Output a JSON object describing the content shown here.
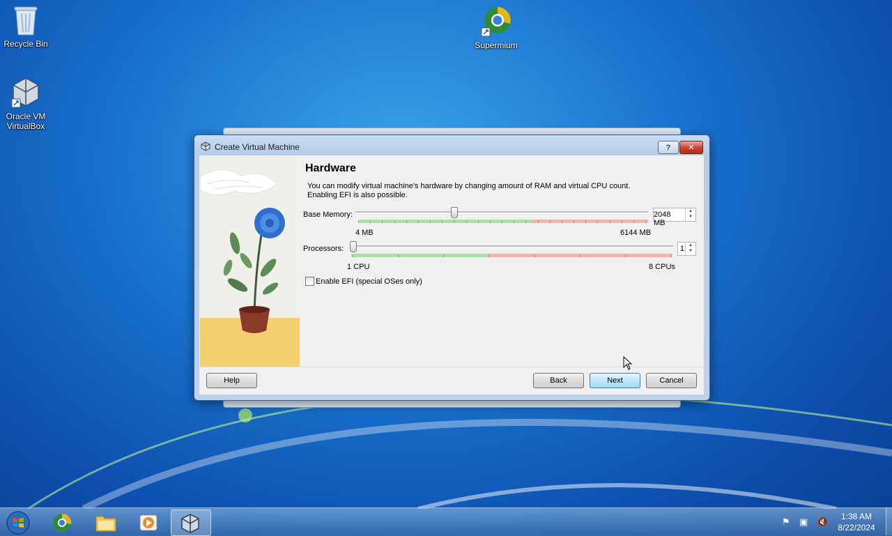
{
  "desktop": {
    "icons": [
      {
        "label": "Recycle Bin",
        "icon": "recycle-bin-icon"
      },
      {
        "label": "Oracle VM VirtualBox",
        "icon": "virtualbox-icon"
      },
      {
        "label": "Supermium",
        "icon": "supermium-browser-icon"
      }
    ]
  },
  "dialog": {
    "title": "Create Virtual Machine",
    "help_button": "?",
    "close_button": "✕",
    "page_title": "Hardware",
    "description_line1": "You can modify virtual machine's hardware by changing amount of RAM and virtual CPU count.",
    "description_line2": "Enabling EFI is also possible.",
    "memory": {
      "label": "Base Memory:",
      "value": "2048 MB",
      "min_label": "4 MB",
      "max_label": "6144 MB",
      "value_mb": 2048,
      "min_mb": 4,
      "max_mb": 6144
    },
    "processors": {
      "label": "Processors:",
      "value": "1",
      "min_label": "1 CPU",
      "max_label": "8 CPUs",
      "value_count": 1,
      "min_count": 1,
      "max_count": 8
    },
    "efi": {
      "label": "Enable EFI (special OSes only)",
      "checked": false
    },
    "buttons": {
      "help": "Help",
      "back": "Back",
      "next": "Next",
      "cancel": "Cancel"
    }
  },
  "taskbar": {
    "apps": [
      "start-orb",
      "supermium",
      "windows-explorer",
      "media-player",
      "virtualbox"
    ],
    "time": "1:38 AM",
    "date": "8/22/2024"
  },
  "colors": {
    "slider_green": "#a6e3a1",
    "slider_red": "#f4b3aa",
    "accent": "#3c7fb1"
  }
}
